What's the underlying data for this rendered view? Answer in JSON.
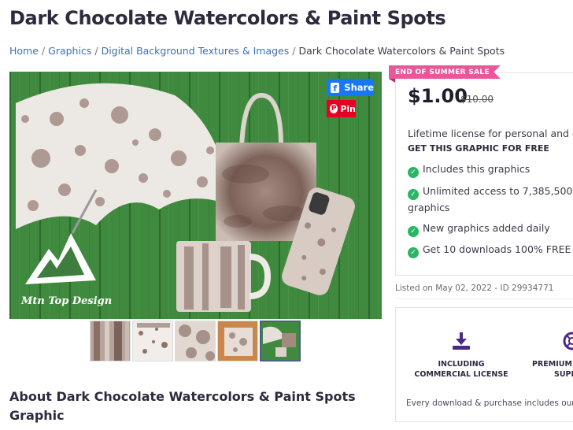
{
  "page": {
    "title": "Dark Chocolate Watercolors & Paint Spots",
    "about_heading": "About Dark Chocolate Watercolors & Paint Spots Graphic"
  },
  "breadcrumb": [
    {
      "label": "Home",
      "link": true
    },
    {
      "label": "Graphics",
      "link": true
    },
    {
      "label": "Digital Background Textures & Images",
      "link": true
    },
    {
      "label": "Dark Chocolate Watercolors & Paint Spots",
      "link": false
    }
  ],
  "hero": {
    "logo_text": "Mtn Top Design",
    "share_label": "Share",
    "pin_label": "Pin"
  },
  "thumbnails": {
    "count": 5,
    "active_index": 4
  },
  "pricing": {
    "ribbon": "END OF SUMMER SALE",
    "price": "$1.00",
    "old_price": "$10.00",
    "license_text": "Lifetime license for personal and co",
    "free_cta": "GET THIS GRAPHIC FOR FREE",
    "features": [
      "Includes this graphics",
      "Unlimited access to 7,385,500 graphics",
      "New graphics added daily",
      "Get 10 downloads 100% FREE"
    ]
  },
  "listing": {
    "text": "Listed on May 02, 2022 - ID 29934771"
  },
  "benefits": {
    "commercial": "INCLUDING COMMERCIAL LICENSE",
    "premium_line1": "PREMIUM T",
    "premium_line2": "SUPP",
    "footer": "Every download & purchase includes our co"
  },
  "colors": {
    "accent_blue": "#1877f2",
    "pin_red": "#e60023",
    "ribbon_pink": "#e9579a",
    "check_green": "#2ab663",
    "icon_purple": "#4b2a86"
  }
}
